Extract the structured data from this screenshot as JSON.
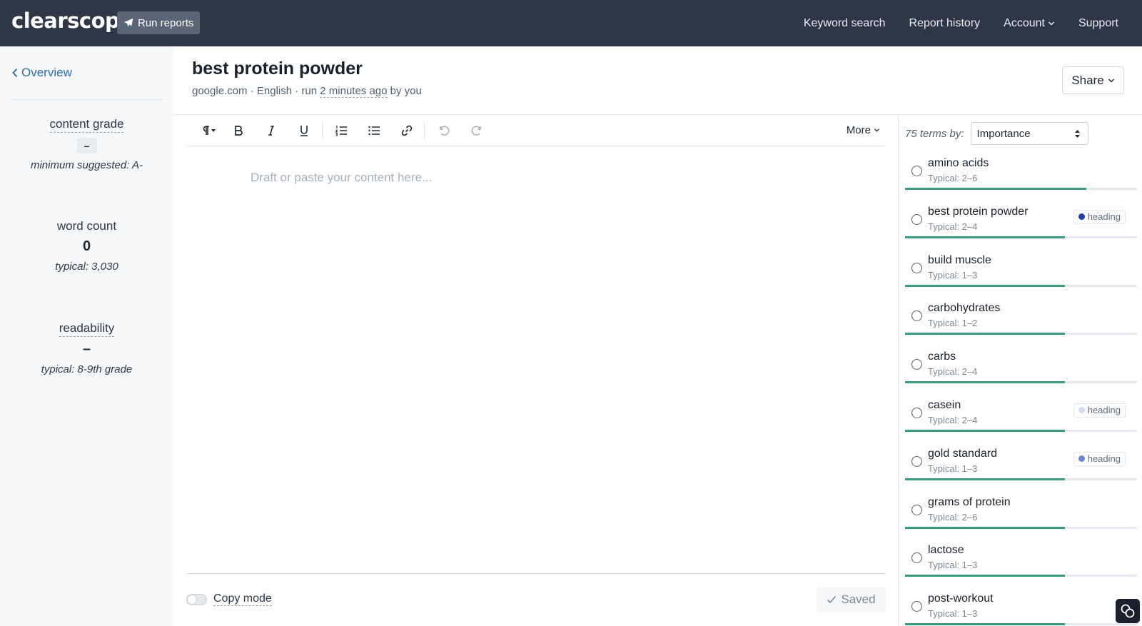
{
  "app": {
    "logo": "clearscope",
    "run_reports": "Run reports",
    "nav": {
      "keyword_search": "Keyword search",
      "report_history": "Report history",
      "account": "Account",
      "support": "Support"
    }
  },
  "sidebar": {
    "overview": "Overview",
    "content_grade": {
      "title": "content grade",
      "value": "–",
      "note": "minimum suggested: A-"
    },
    "word_count": {
      "title": "word count",
      "value": "0",
      "note": "typical: 3,030"
    },
    "readability": {
      "title": "readability",
      "value": "–",
      "note": "typical: 8-9th grade"
    }
  },
  "report": {
    "title": "best protein powder",
    "meta_prefix": "google.com · English · run ",
    "meta_time": "2 minutes ago",
    "meta_suffix": " by you",
    "share": "Share"
  },
  "editor": {
    "more": "More",
    "placeholder": "Draft or paste your content here...",
    "copy_mode": "Copy mode",
    "saved": "Saved"
  },
  "terms": {
    "count_label": "75 terms by:",
    "sort_by": "Importance",
    "items": [
      {
        "name": "amino acids",
        "typical": "Typical: 2–6",
        "tag": "",
        "progress": 0.78
      },
      {
        "name": "best protein powder",
        "typical": "Typical: 2–4",
        "tag": "heading",
        "tag_color": "#1c3fae",
        "progress": 0.69
      },
      {
        "name": "build muscle",
        "typical": "Typical: 1–3",
        "tag": "",
        "progress": 0.69
      },
      {
        "name": "carbohydrates",
        "typical": "Typical: 1–2",
        "tag": "",
        "progress": 0.69
      },
      {
        "name": "carbs",
        "typical": "Typical: 2–4",
        "tag": "",
        "progress": 0.69
      },
      {
        "name": "casein",
        "typical": "Typical: 2–4",
        "tag": "heading",
        "tag_color": "#d6dbf5",
        "progress": 0.69
      },
      {
        "name": "gold standard",
        "typical": "Typical: 1–3",
        "tag": "heading",
        "tag_color": "#6d86d9",
        "progress": 0.69
      },
      {
        "name": "grams of protein",
        "typical": "Typical: 2–6",
        "tag": "",
        "progress": 0.69
      },
      {
        "name": "lactose",
        "typical": "Typical: 1–3",
        "tag": "",
        "progress": 0.69
      },
      {
        "name": "post-workout",
        "typical": "Typical: 1–3",
        "tag": "",
        "progress": 0.69
      }
    ]
  },
  "colors": {
    "topbar": "#2d3748",
    "link": "#2b6cb0",
    "progress": "#3c9a7e"
  }
}
